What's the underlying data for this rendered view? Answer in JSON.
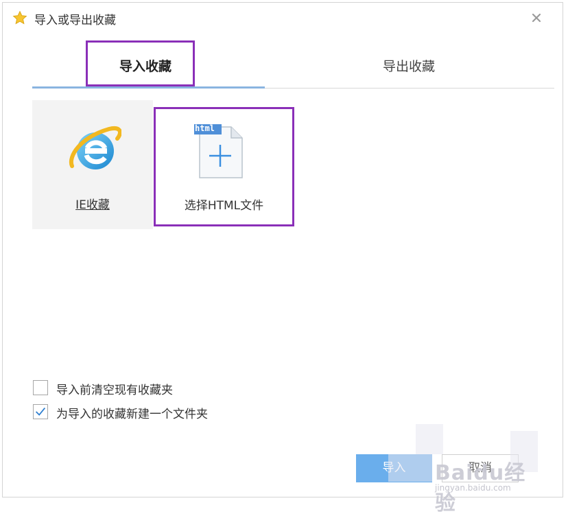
{
  "window": {
    "title": "导入或导出收藏",
    "star_icon": "star-icon",
    "close_icon": "close-icon"
  },
  "tabs": [
    {
      "label": "导入收藏",
      "active": true
    },
    {
      "label": "导出收藏",
      "active": false
    }
  ],
  "sources": [
    {
      "label": "IE收藏",
      "icon": "ie-icon"
    },
    {
      "label": "选择HTML文件",
      "icon": "html-file-add-icon",
      "badge": "html"
    }
  ],
  "options": [
    {
      "label": "导入前清空现有收藏夹",
      "checked": false
    },
    {
      "label": "为导入的收藏新建一个文件夹",
      "checked": true
    }
  ],
  "buttons": {
    "import_label": "导入",
    "cancel_label": "取消"
  },
  "watermark": {
    "logo": "Baidu经验",
    "url": "jingyan.baidu.com"
  },
  "colors": {
    "highlight": "#8a2fb8",
    "primary_button": "#6aaeec",
    "tab_underline": "#8ab4e0"
  }
}
